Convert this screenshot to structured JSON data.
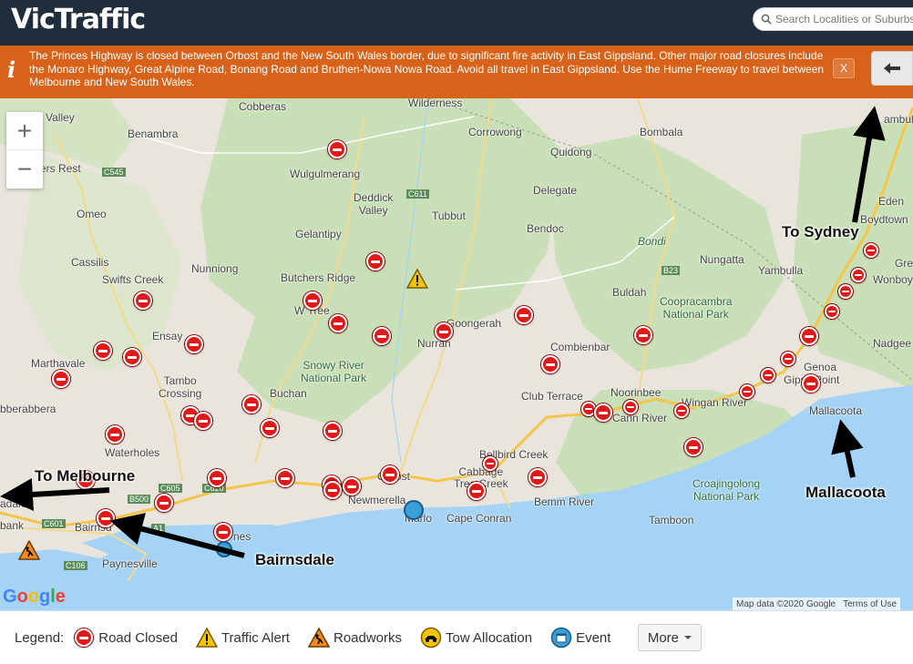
{
  "header": {
    "logo": "VicTraffic",
    "search_placeholder": "Search Localities or Suburbs"
  },
  "alert": {
    "icon": "i",
    "text": "The Princes Highway is closed between Orbost and the New South Wales border, due to significant fire activity in East Gippsland. Other major road closures include the Monaro Highway, Great Alpine Road, Bonang Road and Bruthen-Nowa Nowa Road. Avoid all travel in East Gippsland. Use the Hume Freeway to travel between Melbourne and New South Wales.",
    "close_label": "X",
    "back_icon": "arrow-left-icon"
  },
  "map": {
    "zoom_in": "+",
    "zoom_out": "−",
    "labels": {
      "valley": "Valley",
      "benambra": "Benambra",
      "cobberas": "Cobberas",
      "wilderness": "Wilderness",
      "corrowong": "Corrowong",
      "bombala": "Bombala",
      "quidong": "Quidong",
      "wulgulmerang": "Wulgulmerang",
      "delegate": "Delegate",
      "deddick": "Deddick\nValley",
      "tubbut": "Tubbut",
      "bendoc": "Bendoc",
      "bondi": "Bondi",
      "gelantipy": "Gelantipy",
      "omeo": "Omeo",
      "rivers_rest": "rers Rest",
      "cassilis": "Cassilis",
      "nunniong": "Nunniong",
      "swifts_creek": "Swifts Creek",
      "butchers_ridge": "Butchers Ridge",
      "nungatta": "Nungatta",
      "yambulla": "Yambulla",
      "buldah": "Buldah",
      "coopracambra": "Coopracambra\nNational Park",
      "wtree": "W Tree",
      "ensay": "Ensay",
      "goongerah": "Goongerah",
      "nurran": "Nurran",
      "combienbar": "Combienbar",
      "marthavale": "Marthavale",
      "snowy_river": "Snowy River\nNational Park",
      "tambo_crossing": "Tambo\nCrossing",
      "buchan": "Buchan",
      "club_terrace": "Club Terrace",
      "noorinbee": "Noorinbee",
      "cann_river": "Cann River",
      "wingan_river": "Wingan River",
      "genoa": "Genoa",
      "gipsy_point": "Gipsy Point",
      "mallacoota_town": "Mallacoota",
      "nadgee": "Nadgee",
      "eden": "Eden",
      "boydtown": "Boydtown",
      "wonboyn": "Wonboy",
      "grey": "Gre",
      "pambula": "ambul",
      "berambra": "bberabbera",
      "waterholes": "Waterholes",
      "bellbird_creek": "Bellbird Creek",
      "cabbage_tree": "Cabbage\nTree Creek",
      "orbost": "Orbost",
      "newmerella": "Newmerella",
      "marlo": "Marlo",
      "cape_conran": "Cape Conran",
      "bemm_river": "Bemm River",
      "croajingolong": "Croajingolong\nNational Park",
      "tamboon": "Tamboon",
      "bairnsdale_town": "Bairnsd",
      "paynesville": "Paynesville",
      "bank": "bank",
      "adale": "adale",
      "nes": "nes",
      "c545": "C545",
      "c611": "C611",
      "b23": "B23",
      "c601": "C601",
      "c106": "C106",
      "a1": "A1",
      "c620": "C620",
      "b500": "B500",
      "c605": "C605"
    },
    "annotations": {
      "to_sydney": "To Sydney",
      "to_melbourne": "To Melbourne",
      "mallacoota": "Mallacoota",
      "bairnsdale": "Bairnsdale"
    },
    "google_logo": "Google",
    "attribution": {
      "data": "Map data ©2020 Google",
      "terms": "Terms of Use"
    },
    "road_closed_count": 52,
    "traffic_alert_count": 1,
    "roadworks_count": 1,
    "event_count": 2
  },
  "legend": {
    "title": "Legend:",
    "items": [
      {
        "label": "Road Closed",
        "icon": "road-closed-icon",
        "color": "#e01818"
      },
      {
        "label": "Traffic Alert",
        "icon": "traffic-alert-icon",
        "color": "#f5c400"
      },
      {
        "label": "Roadworks",
        "icon": "roadworks-icon",
        "color": "#f08a1c"
      },
      {
        "label": "Tow Allocation",
        "icon": "tow-allocation-icon",
        "color": "#f5c400"
      },
      {
        "label": "Event",
        "icon": "event-icon",
        "color": "#3aa0d8"
      }
    ],
    "more_label": "More"
  },
  "colors": {
    "header_bg": "#1f2d3d",
    "alert_bg": "#d9621a",
    "sea": "#a4d3f5",
    "land": "#e9e5dc",
    "park": "#c9dfb7",
    "road_closed": "#e01818"
  }
}
